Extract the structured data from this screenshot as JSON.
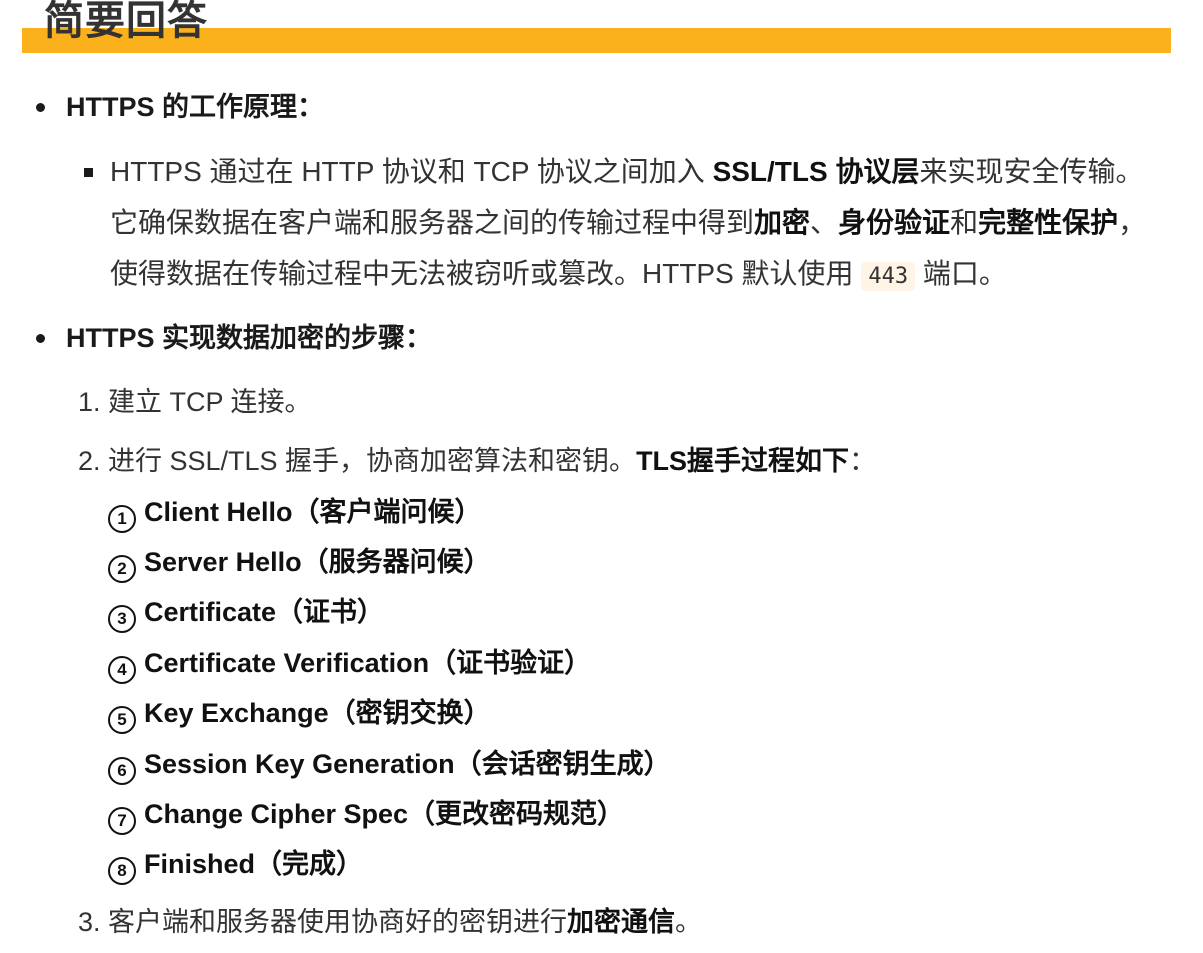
{
  "heading": "简要回答",
  "section1": {
    "title": "HTTPS 的工作原理：",
    "para": {
      "p1": "HTTPS 通过在 HTTP 协议和 TCP 协议之间加入 ",
      "b1": "SSL/TLS 协议层",
      "p2": "来实现安全传输。它确保数据在客户端和服务器之间的传输过程中得到",
      "b2": "加密",
      "p3": "、",
      "b3": "身份验证",
      "p4": "和",
      "b4": "完整性保护",
      "p5": "，使得数据在传输过程中无法被窃听或篡改。HTTPS 默认使用 ",
      "code": "443",
      "p6": " 端口。"
    }
  },
  "section2": {
    "title": "HTTPS 实现数据加密的步骤：",
    "steps": [
      {
        "num": "1.",
        "text": "建立 TCP 连接。"
      },
      {
        "num": "2.",
        "text": "进行 SSL/TLS 握手，协商加密算法和密钥。",
        "bold": "TLS握手过程如下",
        "tail": "："
      },
      {
        "num": "3.",
        "text": "客户端和服务器使用协商好的密钥进行",
        "bold": "加密通信",
        "tail": "。"
      }
    ],
    "handshake": [
      {
        "marker": "1",
        "label": "Client Hello（客户端问候）"
      },
      {
        "marker": "2",
        "label": "Server Hello（服务器问候）"
      },
      {
        "marker": "3",
        "label": "Certificate（证书）"
      },
      {
        "marker": "4",
        "label": "Certificate Verification（证书验证）"
      },
      {
        "marker": "5",
        "label": "Key Exchange（密钥交换）"
      },
      {
        "marker": "6",
        "label": "Session Key Generation（会话密钥生成）"
      },
      {
        "marker": "7",
        "label": "Change Cipher Spec（更改密码规范）"
      },
      {
        "marker": "8",
        "label": "Finished（完成）"
      }
    ]
  },
  "colors": {
    "accent": "#fbb11b",
    "code_bg": "#fff5e6"
  }
}
